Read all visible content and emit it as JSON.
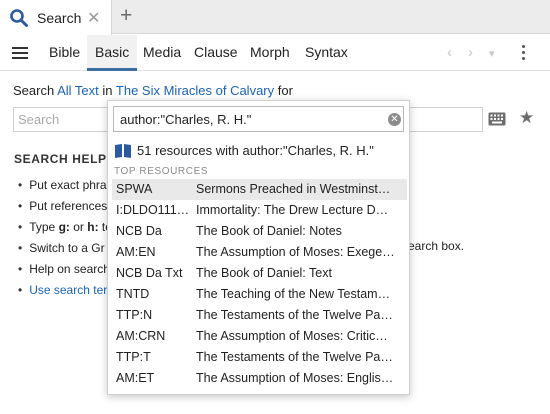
{
  "tab": {
    "label": "Search",
    "close": "✕",
    "new_tab": "+"
  },
  "nav": {
    "tabs": [
      "Bible",
      "Basic",
      "Media",
      "Clause",
      "Morph",
      "Syntax"
    ],
    "active": "Basic"
  },
  "toolbar_right": {
    "back": "‹",
    "forward": "›",
    "menu": "▾"
  },
  "search_line": {
    "prefix": "Search",
    "scope": "All Text",
    "mid": "in",
    "resource": "The Six Miracles of Calvary",
    "suffix": "for"
  },
  "search": {
    "placeholder": "Search"
  },
  "helps": {
    "title": "SEARCH HELPS",
    "items": [
      "Put exact phra",
      "Put references",
      "Type g: or h: to",
      "Switch to a Gr",
      "Help on search"
    ],
    "type_g": "g:",
    "type_h": "h:",
    "link_item": "Use search ter",
    "tail": "earch box."
  },
  "dropdown": {
    "query": "author:\"Charles, R. H.\"",
    "summary": "51 resources with author:\"Charles, R. H.\"",
    "section": "TOP RESOURCES",
    "results": [
      {
        "abbr": "SPWA",
        "title": "Sermons Preached in Westminst…"
      },
      {
        "abbr": "I:DLDO111…",
        "title": "Immortality: The Drew Lecture D…"
      },
      {
        "abbr": "NCB Da",
        "title": "The Book of Daniel: Notes"
      },
      {
        "abbr": "AM:EN",
        "title": "The Assumption of Moses: Exege…"
      },
      {
        "abbr": "NCB Da Txt",
        "title": "The Book of Daniel: Text"
      },
      {
        "abbr": "TNTD",
        "title": "The Teaching of the New Testam…"
      },
      {
        "abbr": "TTP:N",
        "title": "The Testaments of the Twelve Pa…"
      },
      {
        "abbr": "AM:CRN",
        "title": "The Assumption of Moses: Critic…"
      },
      {
        "abbr": "TTP:T",
        "title": "The Testaments of the Twelve Pa…"
      },
      {
        "abbr": "AM:ET",
        "title": "The Assumption of Moses: Englis…"
      }
    ]
  },
  "colors": {
    "link": "#1a62b7",
    "active_tab_underline": "#3a6ea5",
    "search_icon": "#2b5aa0"
  }
}
